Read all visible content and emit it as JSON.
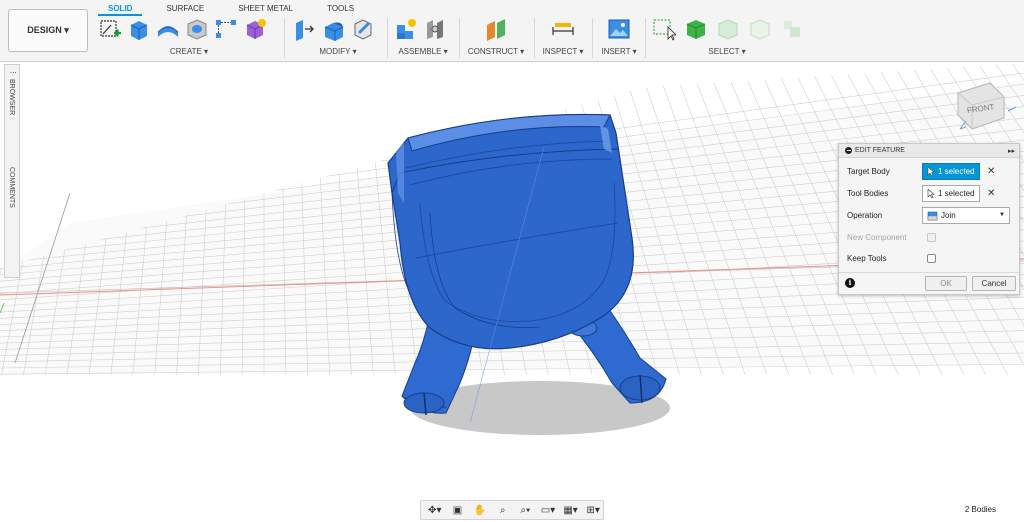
{
  "toolbar": {
    "design_label": "DESIGN ▾",
    "tabs": [
      {
        "label": "SOLID",
        "active": true
      },
      {
        "label": "SURFACE",
        "active": false
      },
      {
        "label": "SHEET METAL",
        "active": false
      },
      {
        "label": "TOOLS",
        "active": false
      }
    ],
    "groups": {
      "create": "CREATE ▾",
      "modify": "MODIFY ▾",
      "assemble": "ASSEMBLE ▾",
      "construct": "CONSTRUCT ▾",
      "inspect": "INSPECT ▾",
      "insert": "INSERT ▾",
      "select": "SELECT ▾"
    }
  },
  "side": {
    "browser": "BROWSER",
    "comments": "COMMENTS"
  },
  "viewcube": {
    "face": "FRONT"
  },
  "edit_feature": {
    "title": "EDIT FEATURE",
    "target_body_label": "Target Body",
    "target_body_value": "1 selected",
    "tool_bodies_label": "Tool Bodies",
    "tool_bodies_value": "1 selected",
    "operation_label": "Operation",
    "operation_value": "Join",
    "new_component_label": "New Component",
    "keep_tools_label": "Keep Tools",
    "ok_label": "OK",
    "cancel_label": "Cancel"
  },
  "status": {
    "bodies": "2 Bodies"
  },
  "colors": {
    "accent": "#0696d7",
    "model_blue": "#1f5fc6"
  }
}
